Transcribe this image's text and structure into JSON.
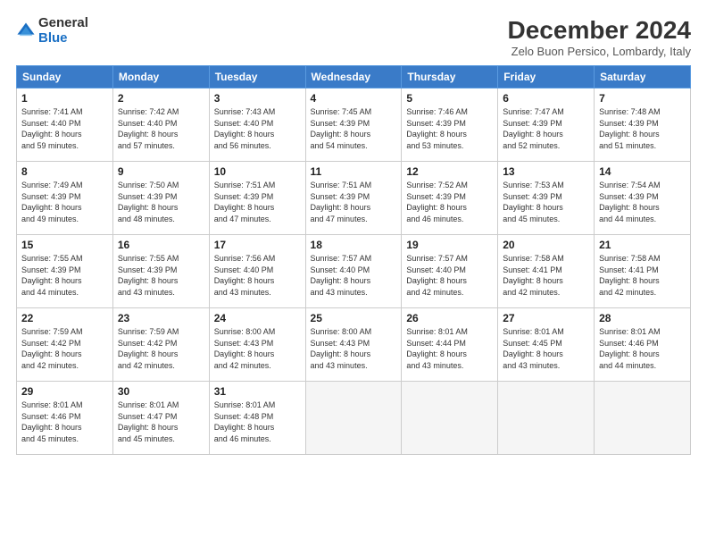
{
  "logo": {
    "general": "General",
    "blue": "Blue"
  },
  "title": "December 2024",
  "location": "Zelo Buon Persico, Lombardy, Italy",
  "days_of_week": [
    "Sunday",
    "Monday",
    "Tuesday",
    "Wednesday",
    "Thursday",
    "Friday",
    "Saturday"
  ],
  "weeks": [
    [
      {
        "day": "1",
        "info": "Sunrise: 7:41 AM\nSunset: 4:40 PM\nDaylight: 8 hours\nand 59 minutes."
      },
      {
        "day": "2",
        "info": "Sunrise: 7:42 AM\nSunset: 4:40 PM\nDaylight: 8 hours\nand 57 minutes."
      },
      {
        "day": "3",
        "info": "Sunrise: 7:43 AM\nSunset: 4:40 PM\nDaylight: 8 hours\nand 56 minutes."
      },
      {
        "day": "4",
        "info": "Sunrise: 7:45 AM\nSunset: 4:39 PM\nDaylight: 8 hours\nand 54 minutes."
      },
      {
        "day": "5",
        "info": "Sunrise: 7:46 AM\nSunset: 4:39 PM\nDaylight: 8 hours\nand 53 minutes."
      },
      {
        "day": "6",
        "info": "Sunrise: 7:47 AM\nSunset: 4:39 PM\nDaylight: 8 hours\nand 52 minutes."
      },
      {
        "day": "7",
        "info": "Sunrise: 7:48 AM\nSunset: 4:39 PM\nDaylight: 8 hours\nand 51 minutes."
      }
    ],
    [
      {
        "day": "8",
        "info": "Sunrise: 7:49 AM\nSunset: 4:39 PM\nDaylight: 8 hours\nand 49 minutes."
      },
      {
        "day": "9",
        "info": "Sunrise: 7:50 AM\nSunset: 4:39 PM\nDaylight: 8 hours\nand 48 minutes."
      },
      {
        "day": "10",
        "info": "Sunrise: 7:51 AM\nSunset: 4:39 PM\nDaylight: 8 hours\nand 47 minutes."
      },
      {
        "day": "11",
        "info": "Sunrise: 7:51 AM\nSunset: 4:39 PM\nDaylight: 8 hours\nand 47 minutes."
      },
      {
        "day": "12",
        "info": "Sunrise: 7:52 AM\nSunset: 4:39 PM\nDaylight: 8 hours\nand 46 minutes."
      },
      {
        "day": "13",
        "info": "Sunrise: 7:53 AM\nSunset: 4:39 PM\nDaylight: 8 hours\nand 45 minutes."
      },
      {
        "day": "14",
        "info": "Sunrise: 7:54 AM\nSunset: 4:39 PM\nDaylight: 8 hours\nand 44 minutes."
      }
    ],
    [
      {
        "day": "15",
        "info": "Sunrise: 7:55 AM\nSunset: 4:39 PM\nDaylight: 8 hours\nand 44 minutes."
      },
      {
        "day": "16",
        "info": "Sunrise: 7:55 AM\nSunset: 4:39 PM\nDaylight: 8 hours\nand 43 minutes."
      },
      {
        "day": "17",
        "info": "Sunrise: 7:56 AM\nSunset: 4:40 PM\nDaylight: 8 hours\nand 43 minutes."
      },
      {
        "day": "18",
        "info": "Sunrise: 7:57 AM\nSunset: 4:40 PM\nDaylight: 8 hours\nand 43 minutes."
      },
      {
        "day": "19",
        "info": "Sunrise: 7:57 AM\nSunset: 4:40 PM\nDaylight: 8 hours\nand 42 minutes."
      },
      {
        "day": "20",
        "info": "Sunrise: 7:58 AM\nSunset: 4:41 PM\nDaylight: 8 hours\nand 42 minutes."
      },
      {
        "day": "21",
        "info": "Sunrise: 7:58 AM\nSunset: 4:41 PM\nDaylight: 8 hours\nand 42 minutes."
      }
    ],
    [
      {
        "day": "22",
        "info": "Sunrise: 7:59 AM\nSunset: 4:42 PM\nDaylight: 8 hours\nand 42 minutes."
      },
      {
        "day": "23",
        "info": "Sunrise: 7:59 AM\nSunset: 4:42 PM\nDaylight: 8 hours\nand 42 minutes."
      },
      {
        "day": "24",
        "info": "Sunrise: 8:00 AM\nSunset: 4:43 PM\nDaylight: 8 hours\nand 42 minutes."
      },
      {
        "day": "25",
        "info": "Sunrise: 8:00 AM\nSunset: 4:43 PM\nDaylight: 8 hours\nand 43 minutes."
      },
      {
        "day": "26",
        "info": "Sunrise: 8:01 AM\nSunset: 4:44 PM\nDaylight: 8 hours\nand 43 minutes."
      },
      {
        "day": "27",
        "info": "Sunrise: 8:01 AM\nSunset: 4:45 PM\nDaylight: 8 hours\nand 43 minutes."
      },
      {
        "day": "28",
        "info": "Sunrise: 8:01 AM\nSunset: 4:46 PM\nDaylight: 8 hours\nand 44 minutes."
      }
    ],
    [
      {
        "day": "29",
        "info": "Sunrise: 8:01 AM\nSunset: 4:46 PM\nDaylight: 8 hours\nand 45 minutes."
      },
      {
        "day": "30",
        "info": "Sunrise: 8:01 AM\nSunset: 4:47 PM\nDaylight: 8 hours\nand 45 minutes."
      },
      {
        "day": "31",
        "info": "Sunrise: 8:01 AM\nSunset: 4:48 PM\nDaylight: 8 hours\nand 46 minutes."
      },
      null,
      null,
      null,
      null
    ]
  ]
}
